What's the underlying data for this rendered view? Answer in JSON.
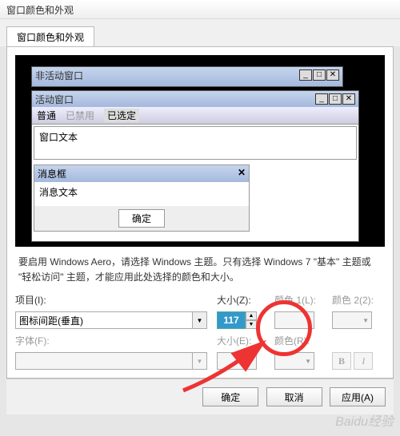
{
  "window": {
    "title": "窗口颜色和外观"
  },
  "tab": {
    "label": "窗口颜色和外观"
  },
  "preview": {
    "inactive_title": "非活动窗口",
    "active_title": "活动窗口",
    "menu": {
      "normal": "普通",
      "disabled": "已禁用",
      "selected": "已选定"
    },
    "window_text": "窗口文本",
    "msgbox_title": "消息框",
    "msg_text": "消息文本",
    "ok": "确定"
  },
  "note": "要启用 Windows Aero，请选择 Windows 主题。只有选择 Windows 7 \"基本\" 主题或 \"轻松访问\" 主题，才能应用此处选择的颜色和大小。",
  "form": {
    "item_label": "项目(I):",
    "item_value": "图标间距(垂直)",
    "size_label": "大小(Z):",
    "size_value": "117",
    "color1_label": "颜色 1(L):",
    "color2_label": "颜色 2(2):",
    "font_label": "字体(F):",
    "fontsize_label": "大小(E):",
    "fontcolor_label": "颜色(R):",
    "bold": "B",
    "italic": "I"
  },
  "footer": {
    "ok": "确定",
    "cancel": "取消",
    "apply": "应用(A)"
  },
  "watermark": "Baidu经验"
}
